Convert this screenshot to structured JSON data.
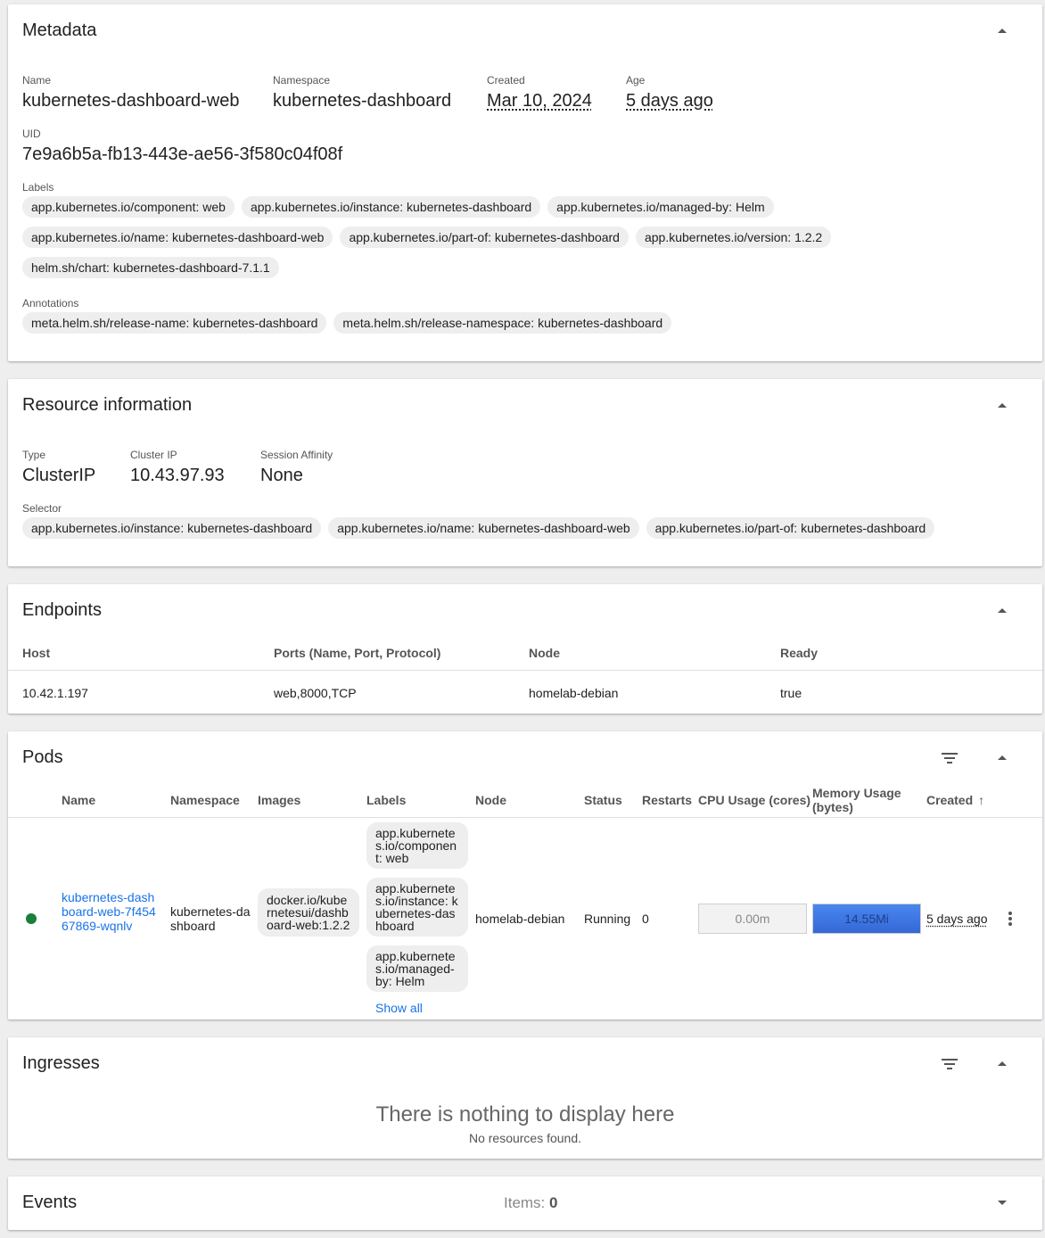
{
  "metadata": {
    "title": "Metadata",
    "fields": [
      {
        "key": "Name",
        "value": "kubernetes-dashboard-web"
      },
      {
        "key": "Namespace",
        "value": "kubernetes-dashboard"
      },
      {
        "key": "Created",
        "value": "Mar 10, 2024"
      },
      {
        "key": "Age",
        "value": "5 days ago"
      }
    ],
    "uid_key": "UID",
    "uid_value": "7e9a6b5a-fb13-443e-ae56-3f580c04f08f",
    "labels_title": "Labels",
    "labels": [
      "app.kubernetes.io/component: web",
      "app.kubernetes.io/instance: kubernetes-dashboard",
      "app.kubernetes.io/managed-by: Helm",
      "app.kubernetes.io/name: kubernetes-dashboard-web",
      "app.kubernetes.io/part-of: kubernetes-dashboard",
      "app.kubernetes.io/version: 1.2.2",
      "helm.sh/chart: kubernetes-dashboard-7.1.1"
    ],
    "annotations_title": "Annotations",
    "annotations": [
      "meta.helm.sh/release-name: kubernetes-dashboard",
      "meta.helm.sh/release-namespace: kubernetes-dashboard"
    ]
  },
  "resource": {
    "title": "Resource information",
    "fields": [
      {
        "key": "Type",
        "value": "ClusterIP"
      },
      {
        "key": "Cluster IP",
        "value": "10.43.97.93"
      },
      {
        "key": "Session Affinity",
        "value": "None"
      }
    ],
    "selector_title": "Selector",
    "selector": [
      "app.kubernetes.io/instance: kubernetes-dashboard",
      "app.kubernetes.io/name: kubernetes-dashboard-web",
      "app.kubernetes.io/part-of: kubernetes-dashboard"
    ]
  },
  "endpoints": {
    "title": "Endpoints",
    "columns": [
      "Host",
      "Ports (Name, Port, Protocol)",
      "Node",
      "Ready"
    ],
    "row": [
      "10.42.1.197",
      "web,8000,TCP",
      "homelab-debian",
      "true"
    ]
  },
  "pods": {
    "title": "Pods",
    "columns": {
      "name": "Name",
      "namespace": "Namespace",
      "images": "Images",
      "labels": "Labels",
      "node": "Node",
      "status": "Status",
      "restarts": "Restarts",
      "cpu": "CPU Usage (cores)",
      "memory": "Memory Usage (bytes)",
      "created": "Created",
      "sort_arrow": "↑"
    },
    "row": {
      "name": "kubernetes-dashboard-web-7f45467869-wqnlv",
      "namespace": "kubernetes-dashboard",
      "image": "docker.io/kubernetesui/dashboard-web:1.2.2",
      "labels": [
        "app.kubernetes.io/component: web",
        "app.kubernetes.io/instance: kubernetes-dashboard",
        "app.kubernetes.io/managed-by: Helm"
      ],
      "show_all": "Show all",
      "node": "homelab-debian",
      "status": "Running",
      "restarts": "0",
      "cpu": "0.00m",
      "memory": "14.55Mi",
      "created": "5 days ago",
      "status_color": "#188038",
      "more_icon": "vertical-dots-icon"
    }
  },
  "ingresses": {
    "title": "Ingresses",
    "empty_title": "There is nothing to display here",
    "empty_subtitle": "No resources found."
  },
  "events": {
    "title": "Events",
    "items_label": "Items:",
    "items_count": "0"
  },
  "colors": {
    "link": "#1a73e8",
    "memory_bar": "#3b78e7",
    "running": "#188038"
  }
}
